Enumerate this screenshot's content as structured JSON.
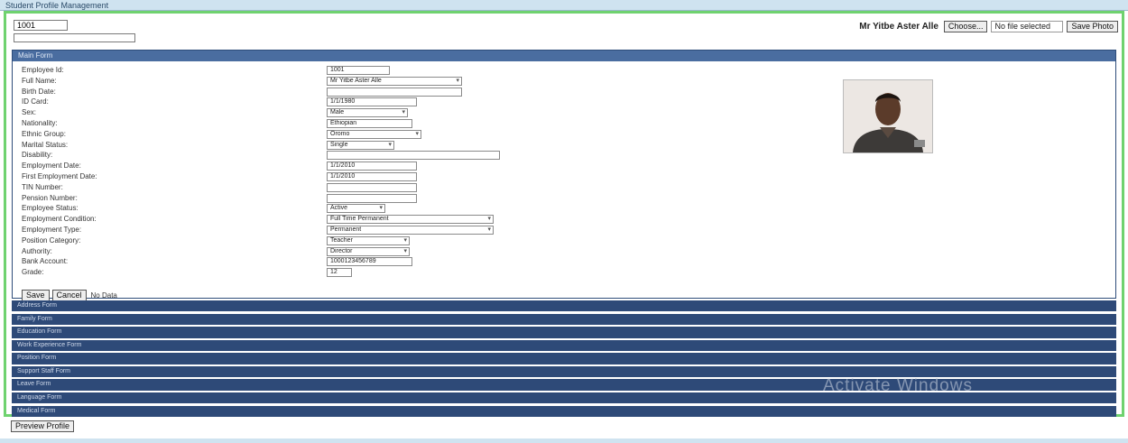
{
  "window": {
    "title": "Student Profile Management"
  },
  "topbar": {
    "emp_id_value": "1001",
    "search_value": "",
    "current_user": "Mr Yitbe Aster Alle",
    "choose_label": "Choose...",
    "file_status": "No file selected",
    "save_photo_label": "Save Photo"
  },
  "main": {
    "header": "Main Form",
    "fields": [
      {
        "label": "Employee Id:",
        "value": "1001",
        "width": 70
      },
      {
        "label": "Full Name:",
        "value": "Mr Yitbe Aster Alle",
        "width": 150,
        "select": true
      },
      {
        "label": "Birth Date:",
        "value": "",
        "width": 150
      },
      {
        "label": "ID Card:",
        "value": "1/1/1980",
        "width": 100
      },
      {
        "label": "Sex:",
        "value": "Male",
        "width": 90,
        "select": true
      },
      {
        "label": "Nationality:",
        "value": "Ethiopian",
        "width": 95
      },
      {
        "label": "Ethnic Group:",
        "value": "Oromo",
        "width": 105,
        "select": true
      },
      {
        "label": "Marital Status:",
        "value": "Single",
        "width": 75,
        "select": true
      },
      {
        "label": "Disability:",
        "value": "",
        "width": 192
      },
      {
        "label": "Employment Date:",
        "value": "1/1/2010",
        "width": 100
      },
      {
        "label": "First Employment Date:",
        "value": "1/1/2010",
        "width": 100
      },
      {
        "label": "TIN Number:",
        "value": "",
        "width": 100
      },
      {
        "label": "Pension Number:",
        "value": "",
        "width": 100
      },
      {
        "label": "Employee Status:",
        "value": "Active",
        "width": 65,
        "select": true
      },
      {
        "label": "Employment Condition:",
        "value": "Full Time Permanent",
        "width": 185,
        "select": true
      },
      {
        "label": "Employment Type:",
        "value": "Permanent",
        "width": 185,
        "select": true
      },
      {
        "label": "Position Category:",
        "value": "Teacher",
        "width": 92,
        "select": true
      },
      {
        "label": "Authority:",
        "value": "Director",
        "width": 92,
        "select": true
      },
      {
        "label": "Bank Account:",
        "value": "1000123456789",
        "width": 95
      },
      {
        "label": "Grade:",
        "value": "12",
        "width": 28
      }
    ],
    "save_label": "Save",
    "cancel_label": "Cancel",
    "note": "No Data"
  },
  "sections": [
    "Address Form",
    "Family Form",
    "Education Form",
    "Work Experience Form",
    "Position Form",
    "Support Staff Form",
    "Leave Form",
    "Language Form",
    "Medical Form"
  ],
  "watermark": "Activate Windows",
  "preview_label": "Preview Profile"
}
